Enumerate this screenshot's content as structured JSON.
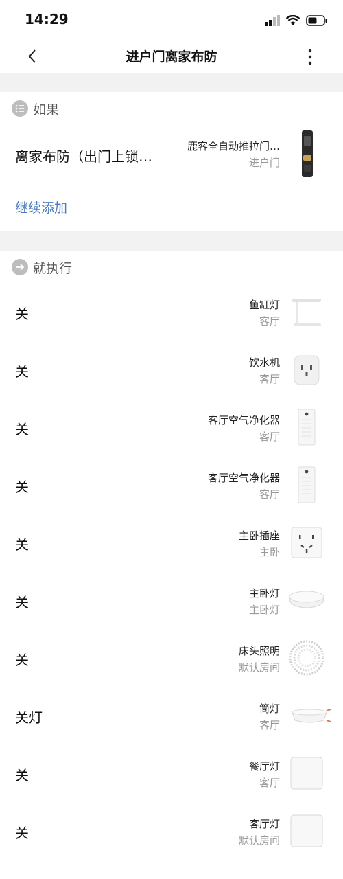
{
  "status": {
    "time": "14:29"
  },
  "nav": {
    "title": "进户门离家布防"
  },
  "if_section": {
    "label": "如果",
    "condition": {
      "name": "离家布防（出门上锁…",
      "device_name": "鹿客全自动推拉门…",
      "device_room": "进户门"
    },
    "add_label": "继续添加"
  },
  "then_section": {
    "label": "就执行",
    "actions": [
      {
        "action": "关",
        "name": "鱼缸灯",
        "room": "客厅",
        "icon": "desk-lamp-icon"
      },
      {
        "action": "关",
        "name": "饮水机",
        "room": "客厅",
        "icon": "smart-plug-icon"
      },
      {
        "action": "关",
        "name": "客厅空气净化器",
        "room": "客厅",
        "icon": "air-purifier-icon"
      },
      {
        "action": "关",
        "name": "客厅空气净化器",
        "room": "客厅",
        "icon": "air-purifier-icon"
      },
      {
        "action": "关",
        "name": "主卧插座",
        "room": "主卧",
        "icon": "wall-socket-icon"
      },
      {
        "action": "关",
        "name": "主卧灯",
        "room": "主卧灯",
        "icon": "ceiling-light-icon"
      },
      {
        "action": "关",
        "name": "床头照明",
        "room": "默认房间",
        "icon": "light-strip-icon"
      },
      {
        "action": "关灯",
        "name": "筒灯",
        "room": "客厅",
        "icon": "downlight-icon"
      },
      {
        "action": "关",
        "name": "餐厅灯",
        "room": "客厅",
        "icon": "light-panel-icon"
      },
      {
        "action": "关",
        "name": "客厅灯",
        "room": "默认房间",
        "icon": "light-panel-icon"
      }
    ]
  },
  "colors": {
    "link": "#4b7ac0",
    "background": "#f2f2f2"
  }
}
